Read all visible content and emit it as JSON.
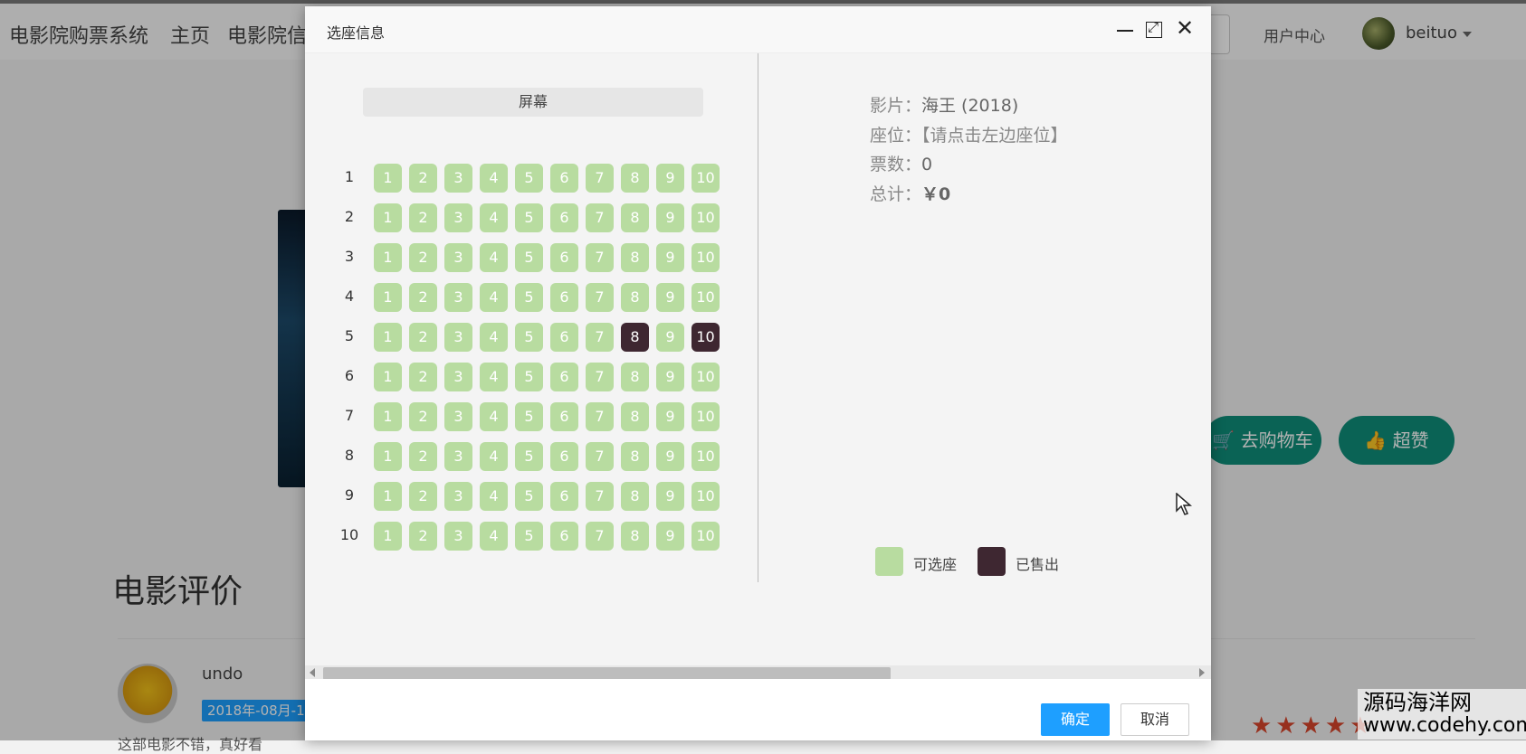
{
  "app": {
    "brand": "电影院购票系统",
    "nav": [
      "主页",
      "电影院信"
    ],
    "user_center": "用户中心",
    "username": "beituo"
  },
  "background": {
    "cart_button": "去购物车",
    "like_button": "超赞",
    "review_title": "电影评价",
    "reviewer_name": "undo",
    "review_date": "2018年-08月-1",
    "review_text": "这部电影不错，真好看"
  },
  "modal": {
    "title": "选座信息",
    "screen_label": "屏幕",
    "rows": [
      "1",
      "2",
      "3",
      "4",
      "5",
      "6",
      "7",
      "8",
      "9",
      "10"
    ],
    "seats": [
      "1",
      "2",
      "3",
      "4",
      "5",
      "6",
      "7",
      "8",
      "9",
      "10"
    ],
    "sold": [
      {
        "row": "5",
        "seat": "8"
      },
      {
        "row": "5",
        "seat": "10"
      }
    ],
    "info": {
      "movie_label": "影片：",
      "movie_value": "海王 (2018)",
      "seat_label": "座位：",
      "seat_value": "【请点击左边座位】",
      "count_label": "票数：",
      "count_value": "0",
      "total_label": "总计：",
      "total_value": "￥0"
    },
    "legend": {
      "available": "可选座",
      "sold": "已售出",
      "available_color": "#b8dca0",
      "sold_color": "#3e2731"
    },
    "ok_button": "确定",
    "cancel_button": "取消"
  },
  "watermark": {
    "line1": "源码海洋网",
    "line2": "www.codehy.com"
  }
}
